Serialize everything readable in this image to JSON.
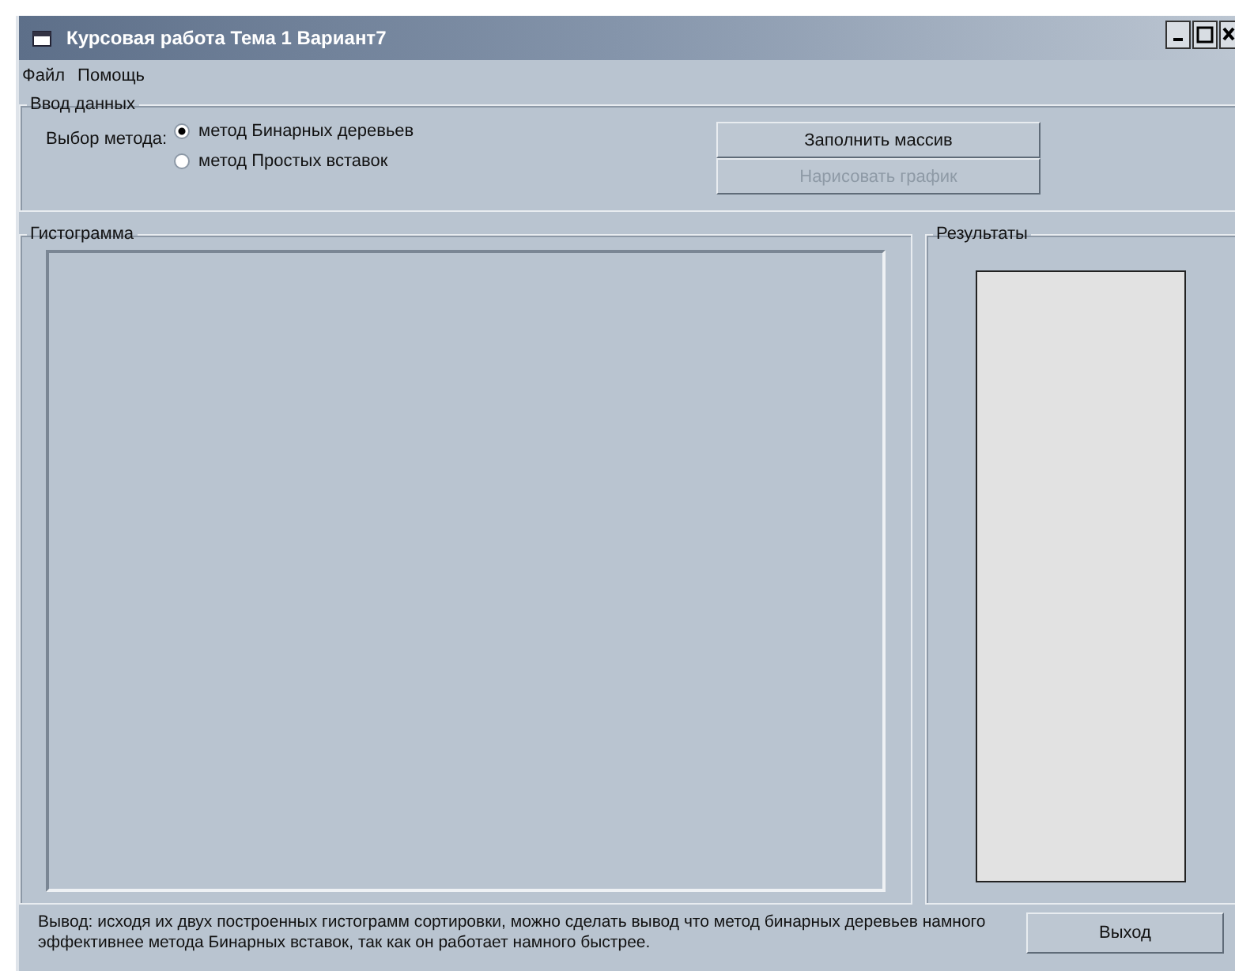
{
  "window": {
    "title": "Курсовая работа Тема 1 Вариант7"
  },
  "menu": [
    "Файл",
    "Помощь"
  ],
  "input_group": {
    "title": "Ввод данных",
    "method_label": "Выбор метода:",
    "methods": [
      {
        "label": "метод Бинарных деревьев",
        "selected": true
      },
      {
        "label": "метод Простых вставок",
        "selected": false
      }
    ],
    "buttons": [
      {
        "label": "Заполнить массив",
        "disabled": false
      },
      {
        "label": "Нарисовать график",
        "disabled": true
      }
    ]
  },
  "histogram": {
    "title": "Гистограмма"
  },
  "results": {
    "title": "Результаты"
  },
  "conclusion": "Вывод: исходя их двух построенных гистограмм сортировки, можно сделать вывод что метод бинарных деревьев намного эффективнее метода Бинарных вставок, так как он работает намного быстрее.",
  "exit_button": "Выход"
}
